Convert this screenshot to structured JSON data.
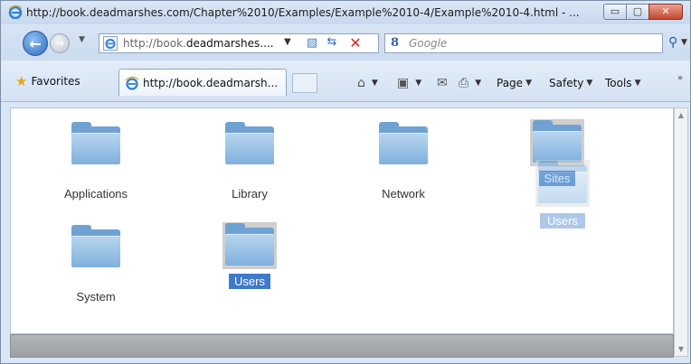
{
  "window": {
    "title": "http://book.deadmarshes.com/Chapter%2010/Examples/Example%2010-4/Example%2010-4.html - ...",
    "minimize_icon": "minimize-icon",
    "maximize_icon": "maximize-icon",
    "close_icon": "close-icon"
  },
  "address_bar": {
    "url_prefix": "http://book.",
    "url_domain": "deadmarshes....",
    "search_engine_badge": "8",
    "search_placeholder": "Google"
  },
  "favorites_bar": {
    "favorites_label": "Favorites",
    "tab_title": "http://book.deadmarsh...",
    "page_label": "Page",
    "safety_label": "Safety",
    "tools_label": "Tools"
  },
  "content": {
    "items": [
      {
        "label": "Applications",
        "selected": false
      },
      {
        "label": "Library",
        "selected": false
      },
      {
        "label": "Network",
        "selected": false
      },
      {
        "label": "Sites",
        "selected": true
      },
      {
        "label": "System",
        "selected": false
      },
      {
        "label": "Users",
        "selected": true
      }
    ],
    "drag_ghost_label": "Users"
  },
  "colors": {
    "selection": "#3d7ac9",
    "folder": "#7fb0dd",
    "status_bar": "#a7aaae"
  }
}
